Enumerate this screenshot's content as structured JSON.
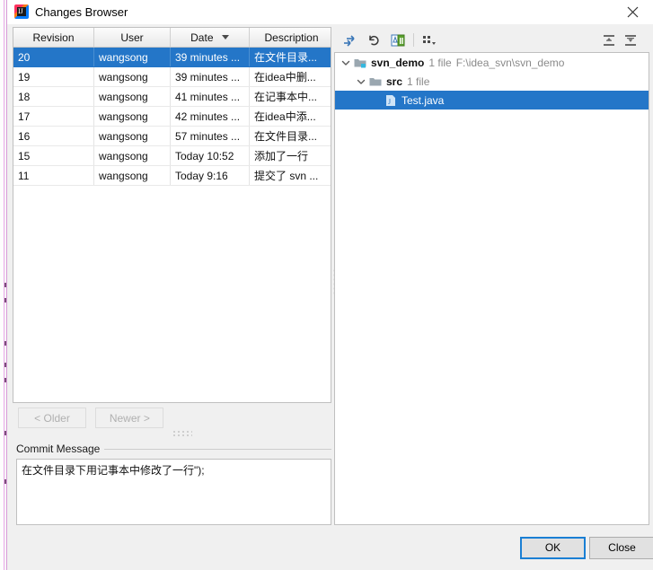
{
  "window": {
    "title": "Changes Browser",
    "app_icon": "intellij-idea-icon",
    "close_icon": "close-icon"
  },
  "colors": {
    "selection_blue": "#2476c8",
    "default_button_border": "#1a7fd4",
    "dialog_bg": "#f0f0f0",
    "panel_bg": "#ffffff",
    "meta_text": "#8a8a8a"
  },
  "revisions_table": {
    "columns": [
      {
        "label": "Revision",
        "sorted": false
      },
      {
        "label": "User",
        "sorted": false
      },
      {
        "label": "Date",
        "sorted": true,
        "sort_icon": "sort-descending-icon"
      },
      {
        "label": "Description",
        "sorted": false
      }
    ],
    "rows": [
      {
        "revision": "20",
        "user": "wangsong",
        "date": "39 minutes ...",
        "description": "在文件目录...",
        "selected": true
      },
      {
        "revision": "19",
        "user": "wangsong",
        "date": "39 minutes ...",
        "description": "在idea中删...",
        "selected": false
      },
      {
        "revision": "18",
        "user": "wangsong",
        "date": "41 minutes ...",
        "description": "在记事本中...",
        "selected": false
      },
      {
        "revision": "17",
        "user": "wangsong",
        "date": "42 minutes ...",
        "description": "在idea中添...",
        "selected": false
      },
      {
        "revision": "16",
        "user": "wangsong",
        "date": "57 minutes ...",
        "description": "在文件目录...",
        "selected": false
      },
      {
        "revision": "15",
        "user": "wangsong",
        "date": "Today 10:52",
        "description": "添加了一行",
        "selected": false
      },
      {
        "revision": "11",
        "user": "wangsong",
        "date": "Today 9:16",
        "description": "提交了 svn ...",
        "selected": false
      }
    ]
  },
  "navigation": {
    "older_label": "< Older",
    "older_enabled": false,
    "newer_label": "Newer >",
    "newer_enabled": false
  },
  "commit_message": {
    "label": "Commit Message",
    "value": "在文件目录下用记事本中修改了一行\");"
  },
  "changes_toolbar": {
    "buttons": [
      {
        "name": "show-diff-icon",
        "tooltip": "Show Diff"
      },
      {
        "name": "revert-icon",
        "tooltip": "Revert"
      },
      {
        "name": "compare-with-icon",
        "tooltip": "Compare"
      },
      {
        "name": "group-by-icon",
        "tooltip": "Group By"
      },
      {
        "name": "expand-all-icon",
        "tooltip": "Expand All"
      },
      {
        "name": "collapse-all-icon",
        "tooltip": "Collapse All"
      }
    ]
  },
  "changes_tree": {
    "nodes": [
      {
        "name": "svn_demo",
        "meta": "1 file",
        "path": "F:\\idea_svn\\svn_demo",
        "icon": "module-folder-icon",
        "depth": 0,
        "expanded": true,
        "selected": false
      },
      {
        "name": "src",
        "meta": "1 file",
        "path": "",
        "icon": "folder-icon",
        "depth": 1,
        "expanded": true,
        "selected": false
      },
      {
        "name": "Test.java",
        "meta": "",
        "path": "",
        "icon": "java-file-icon",
        "depth": 2,
        "expanded": null,
        "selected": true
      }
    ]
  },
  "footer": {
    "ok_label": "OK",
    "close_label": "Close"
  }
}
